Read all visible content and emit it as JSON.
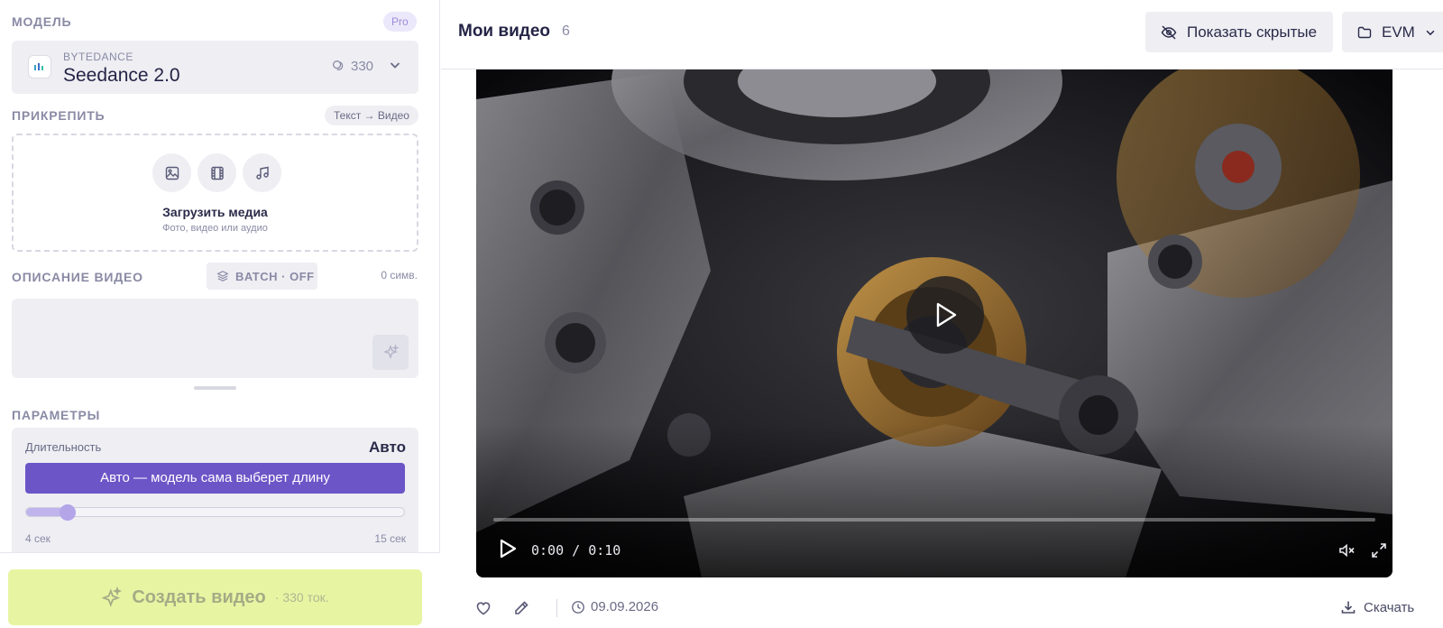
{
  "sidebar": {
    "model_section": "МОДЕЛЬ",
    "plan_badge": "Pro",
    "model": {
      "vendor": "BYTEDANCE",
      "name": "Seedance 2.0",
      "cost": "330"
    },
    "attach_section": "ПРИКРЕПИТЬ",
    "mode_badge": "Текст → Видео",
    "upload": {
      "title": "Загрузить медиа",
      "subtitle": "Фото, видео или аудио",
      "buttons": [
        "image-icon",
        "film-icon",
        "music-icon"
      ]
    },
    "description_section": "ОПИСАНИЕ ВИДЕО",
    "batch_label": "BATCH · OFF",
    "char_count": "0 симв.",
    "description_value": "",
    "params_section": "ПАРАМЕТРЫ",
    "duration": {
      "label": "Длительность",
      "value": "Авто",
      "auto_button": "Авто — модель сама выберет длину",
      "min_label": "4 сек",
      "max_label": "15 сек",
      "slider_fraction": 0.11
    },
    "create_button": "Создать видео",
    "create_cost": "· 330 ток."
  },
  "main": {
    "title": "Мои видео",
    "count": "6",
    "show_hidden_button": "Показать скрытые",
    "folder_button": "EVM",
    "video": {
      "timecode": "0:00 / 0:10"
    },
    "item": {
      "date": "09.09.2026",
      "download_label": "Скачать"
    }
  },
  "colors": {
    "accent": "#6c55c7",
    "create_bg": "#e7f5a3"
  }
}
